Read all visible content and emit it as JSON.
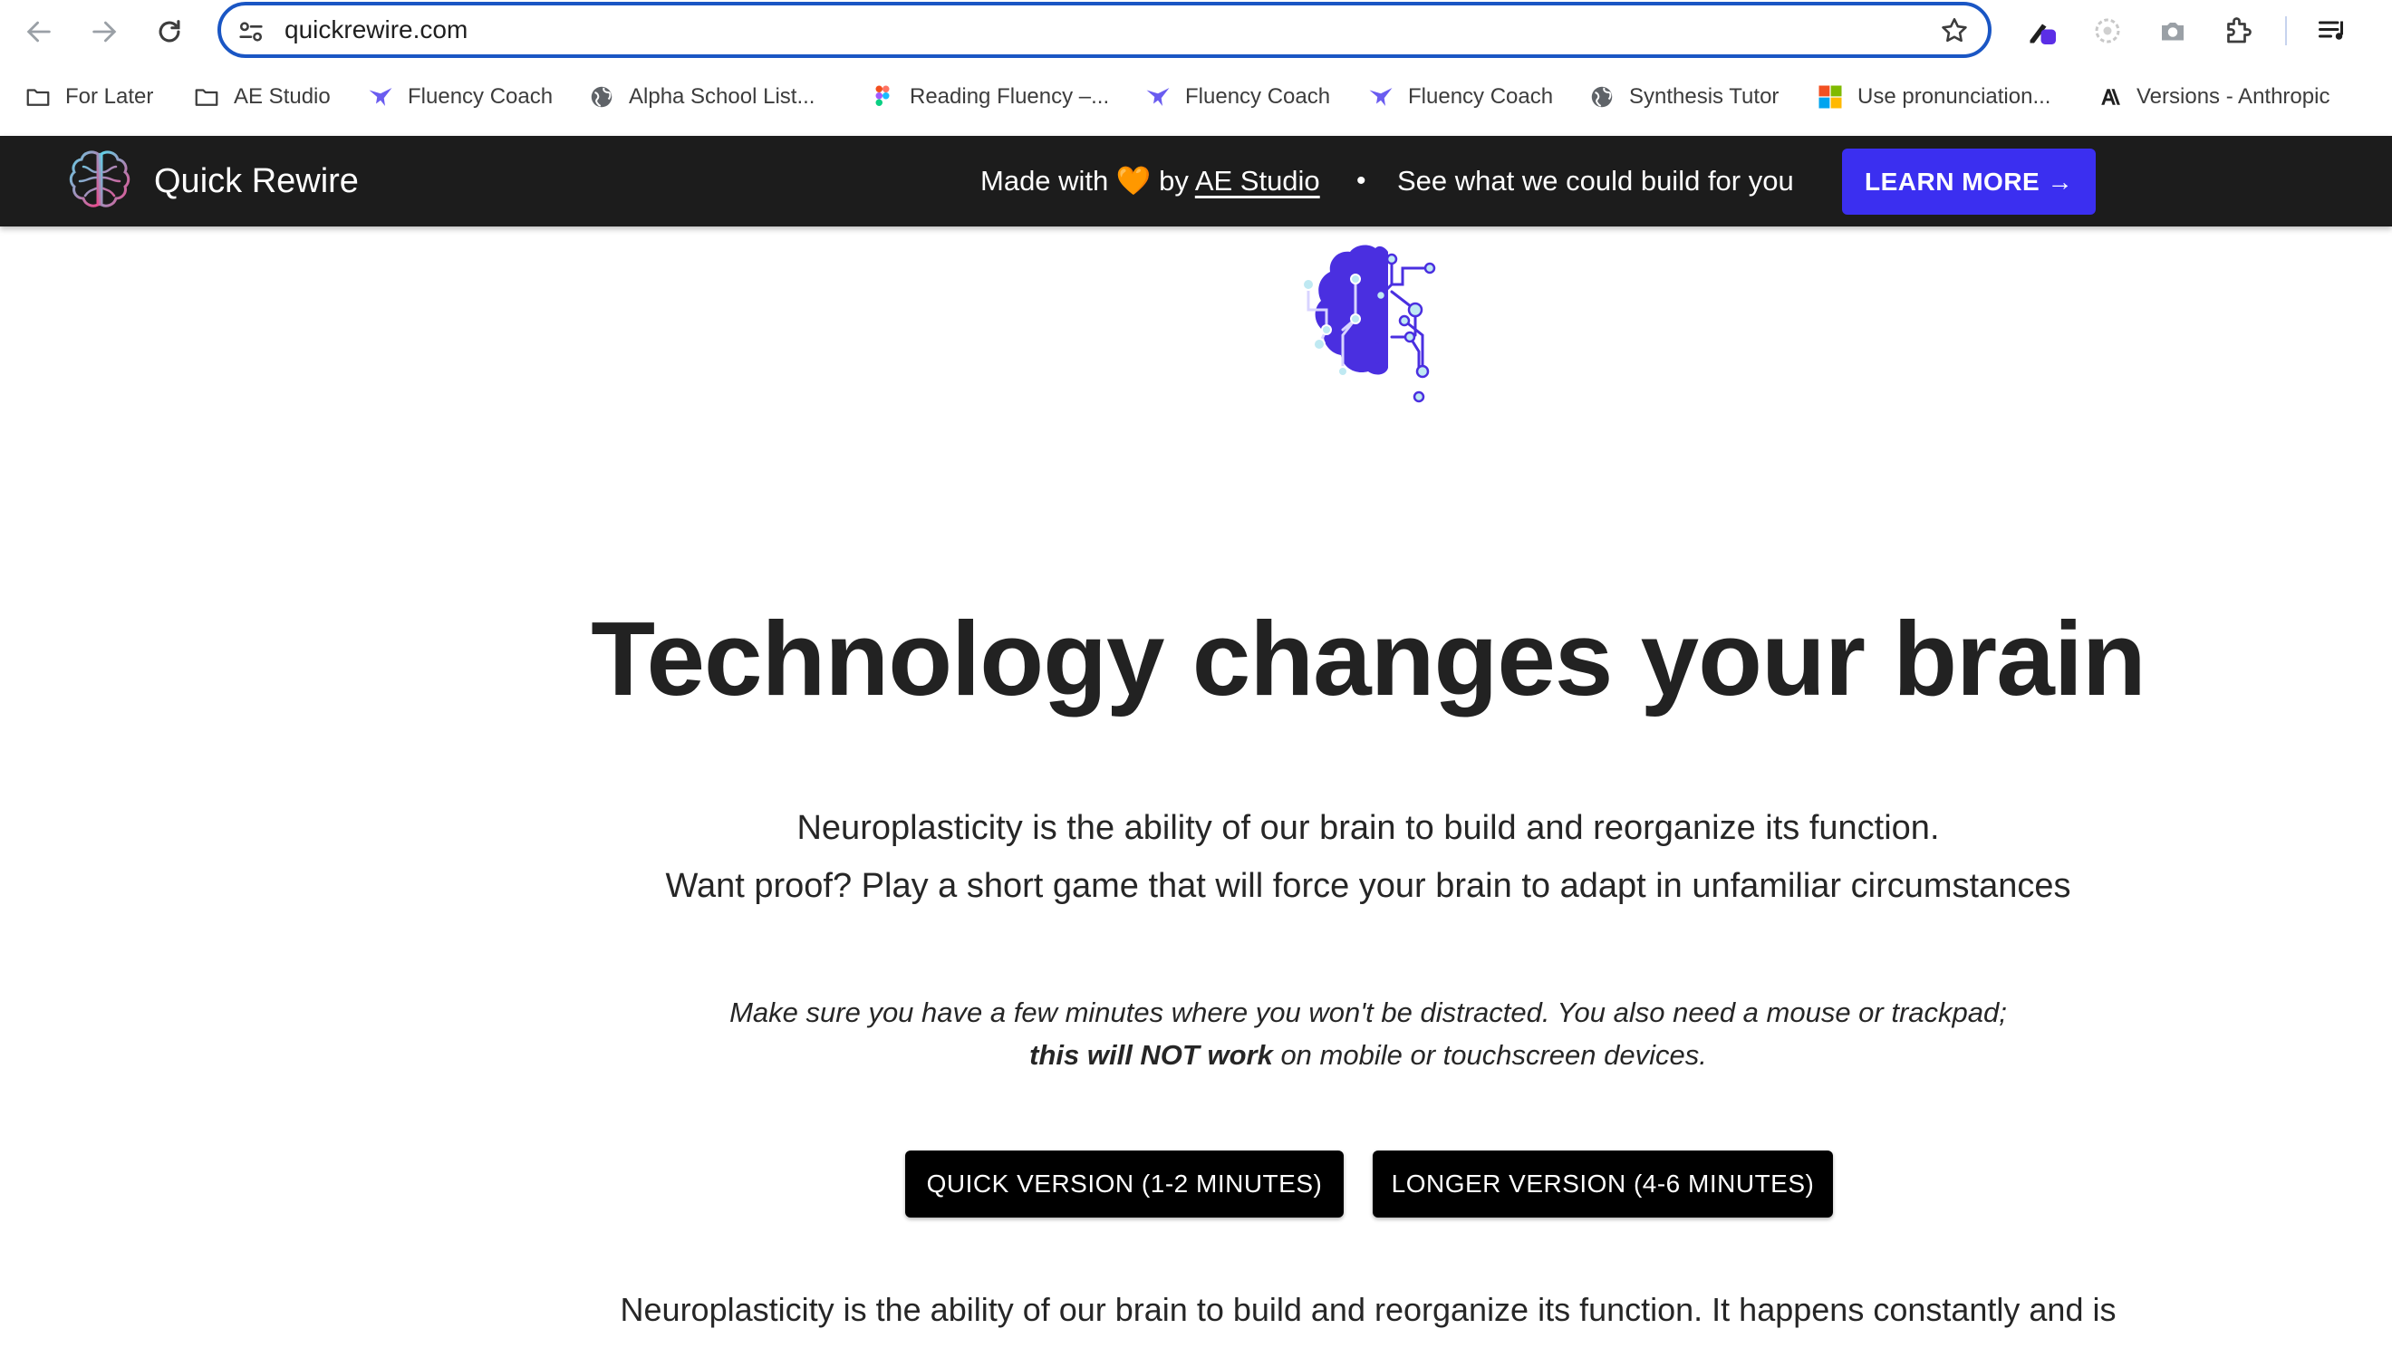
{
  "browser": {
    "url": "quickrewire.com",
    "nav": {
      "back_icon": "arrow-left-icon",
      "forward_icon": "arrow-right-icon",
      "reload_icon": "reload-icon"
    },
    "extensions": [
      "pen-extension-icon",
      "loader-extension-icon",
      "camera-icon",
      "puzzle-extensions-icon",
      "reading-list-icon"
    ]
  },
  "bookmarks": [
    {
      "label": "For Later",
      "icon": "folder-icon"
    },
    {
      "label": "AE Studio",
      "icon": "folder-icon"
    },
    {
      "label": "Fluency Coach",
      "icon": "fluency-coach-icon"
    },
    {
      "label": "Alpha School List...",
      "icon": "globe-icon"
    },
    {
      "label": "Reading Fluency –...",
      "icon": "figma-icon"
    },
    {
      "label": "Fluency Coach",
      "icon": "fluency-coach-icon"
    },
    {
      "label": "Fluency Coach",
      "icon": "fluency-coach-icon"
    },
    {
      "label": "Synthesis Tutor",
      "icon": "globe-icon"
    },
    {
      "label": "Use pronunciation...",
      "icon": "microsoft-icon"
    },
    {
      "label": "Versions - Anthropic",
      "icon": "anthropic-icon"
    }
  ],
  "header": {
    "title": "Quick Rewire",
    "made_with_prefix": "Made with",
    "heart": "🧡",
    "by": "by",
    "studio_link": "AE Studio",
    "separator": "•",
    "pitch": "See what we could build for you",
    "learn_more": "LEARN MORE →"
  },
  "main": {
    "headline": "Technology changes your brain",
    "intro_line1": "Neuroplasticity is the ability of our brain to build and reorganize its function.",
    "intro_line2": "Want proof? Play a short game that will force your brain to adapt in unfamiliar circumstances",
    "note_line1": "Make sure you have a few minutes where you won't be distracted. You also need a mouse or trackpad;",
    "note_bold": "this will NOT work",
    "note_line2_rest": " on mobile or touchscreen devices.",
    "quick_button": "QUICK VERSION (1-2 MINUTES)",
    "longer_button": "LONGER VERSION (4-6 MINUTES)",
    "body_text": "Neuroplasticity is the ability of our brain to build and reorganize its function. It happens constantly and is"
  },
  "colors": {
    "accent": "#3b2ff0",
    "header_bg": "#1c1c1c",
    "omnibox_border": "#1a56c4",
    "brain": "#4a2fe0"
  }
}
